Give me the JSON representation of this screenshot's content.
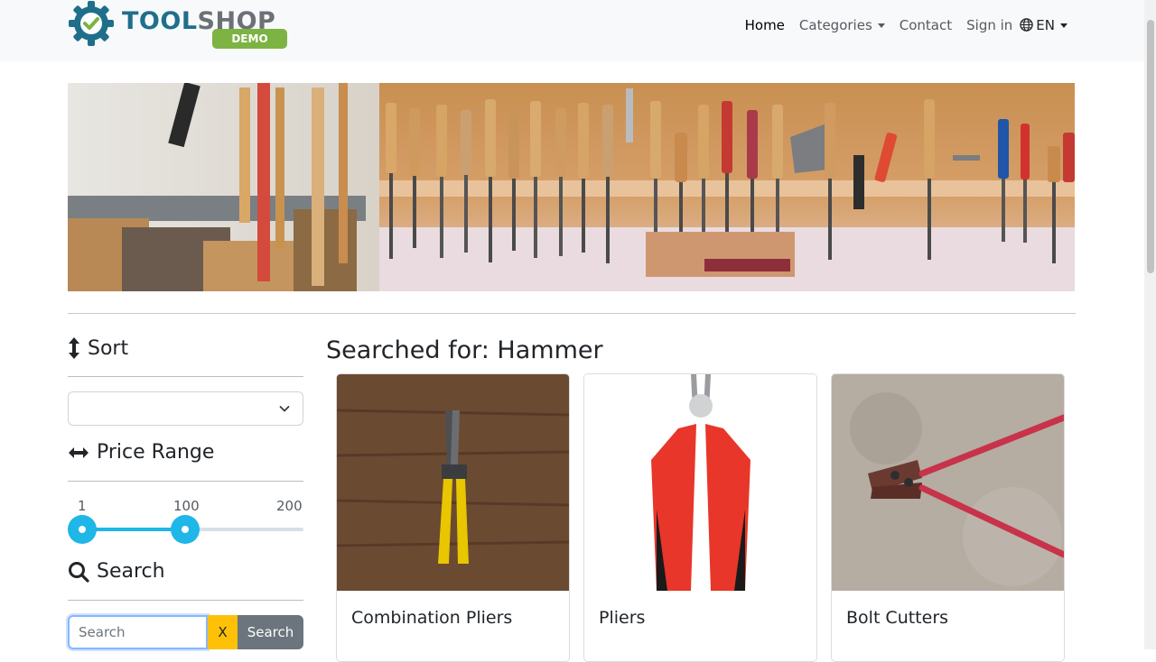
{
  "brand": {
    "name_part1": "TOOL",
    "name_part2": "SHOP",
    "badge": "DEMO"
  },
  "nav": {
    "home": "Home",
    "categories": "Categories",
    "contact": "Contact",
    "signin": "Sign in",
    "language": "EN"
  },
  "sidebar": {
    "sort_heading": "Sort",
    "sort_value": "",
    "price_heading": "Price Range",
    "price_range": {
      "min": 1,
      "max": 200,
      "low": 1,
      "high": 100
    },
    "search_heading": "Search",
    "search": {
      "placeholder": "Search",
      "value": "",
      "clear_label": "X",
      "submit_label": "Search"
    }
  },
  "results": {
    "title": "Searched for: Hammer",
    "products": [
      {
        "name": "Combination Pliers"
      },
      {
        "name": "Pliers"
      },
      {
        "name": "Bolt Cutters"
      }
    ]
  },
  "colors": {
    "accent": "#1fb6e8",
    "brand_green": "#7cb342",
    "clear_button": "#ffc107",
    "search_button": "#6c757d"
  }
}
